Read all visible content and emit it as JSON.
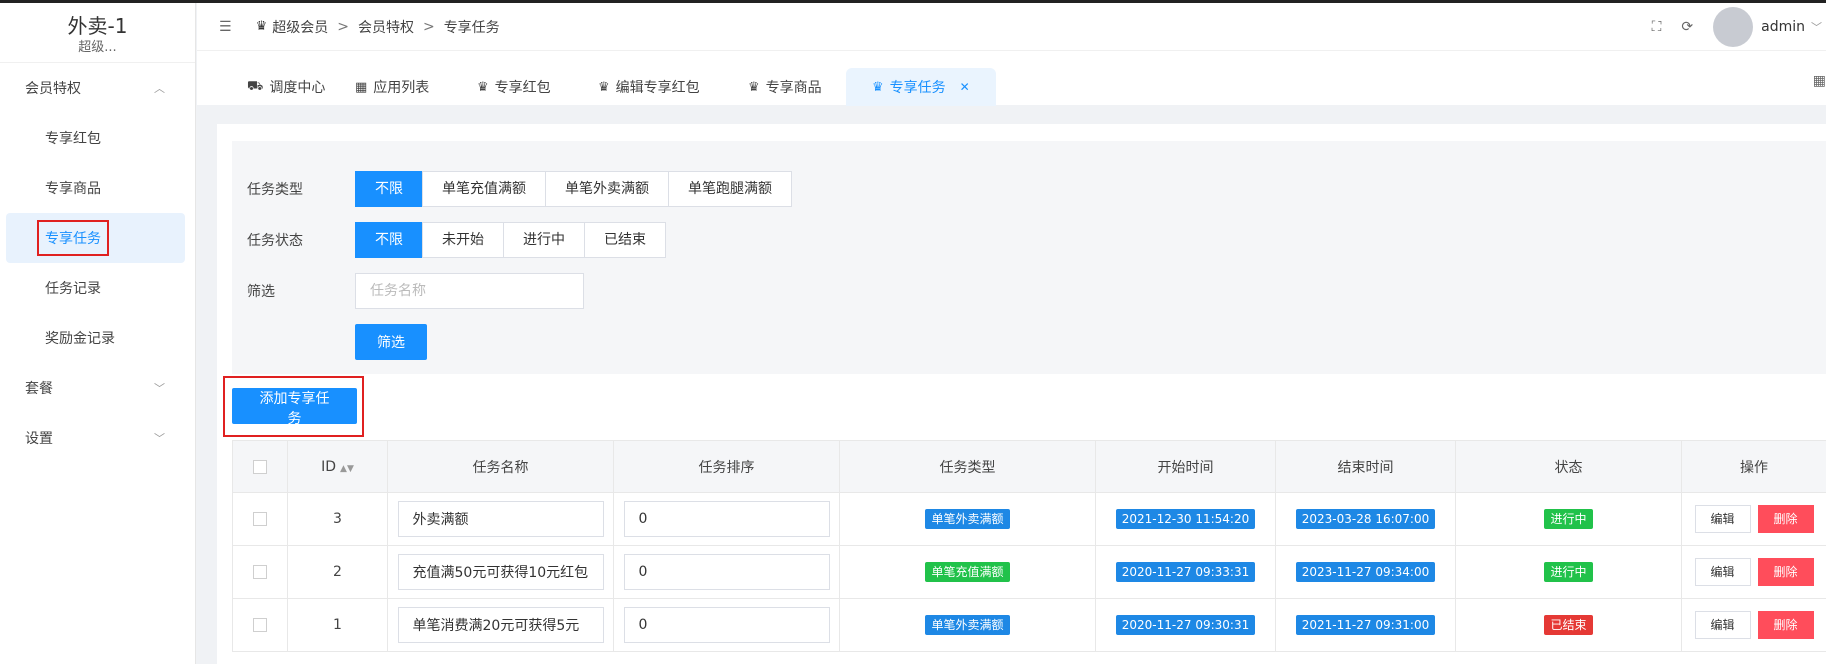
{
  "sidebar": {
    "brand_name": "外卖-1",
    "brand_sub": "超级...",
    "group_member": "会员特权",
    "items": [
      "专享红包",
      "专享商品",
      "专享任务",
      "任务记录",
      "奖励金记录"
    ],
    "group_package": "套餐",
    "group_settings": "设置"
  },
  "header": {
    "crumbs": [
      "超级会员",
      "会员特权",
      "专享任务"
    ],
    "user": "admin"
  },
  "tabs": [
    "调度中心",
    "应用列表",
    "专享红包",
    "编辑专享红包",
    "专享商品",
    "专享任务"
  ],
  "filter": {
    "type_label": "任务类型",
    "type_options": [
      "不限",
      "单笔充值满额",
      "单笔外卖满额",
      "单笔跑腿满额"
    ],
    "status_label": "任务状态",
    "status_options": [
      "不限",
      "未开始",
      "进行中",
      "已结束"
    ],
    "search_label": "筛选",
    "search_placeholder": "任务名称",
    "search_button": "筛选"
  },
  "add_button": "添加专享任务",
  "table": {
    "headers": [
      "ID",
      "任务名称",
      "任务排序",
      "任务类型",
      "开始时间",
      "结束时间",
      "状态",
      "操作"
    ],
    "edit_label": "编辑",
    "delete_label": "删除",
    "rows": [
      {
        "id": "3",
        "name": "外卖满额",
        "sort": "0",
        "type": "单笔外卖满额",
        "start": "2021-12-30 11:54:20",
        "end": "2023-03-28 16:07:00",
        "status": "进行中"
      },
      {
        "id": "2",
        "name": "充值满50元可获得10元红包",
        "sort": "0",
        "type": "单笔充值满额",
        "start": "2020-11-27 09:33:31",
        "end": "2023-11-27 09:34:00",
        "status": "进行中"
      },
      {
        "id": "1",
        "name": "单笔消费满20元可获得5元",
        "sort": "0",
        "type": "单笔外卖满额",
        "start": "2020-11-27 09:30:31",
        "end": "2021-11-27 09:31:00",
        "status": "已结束"
      }
    ]
  }
}
